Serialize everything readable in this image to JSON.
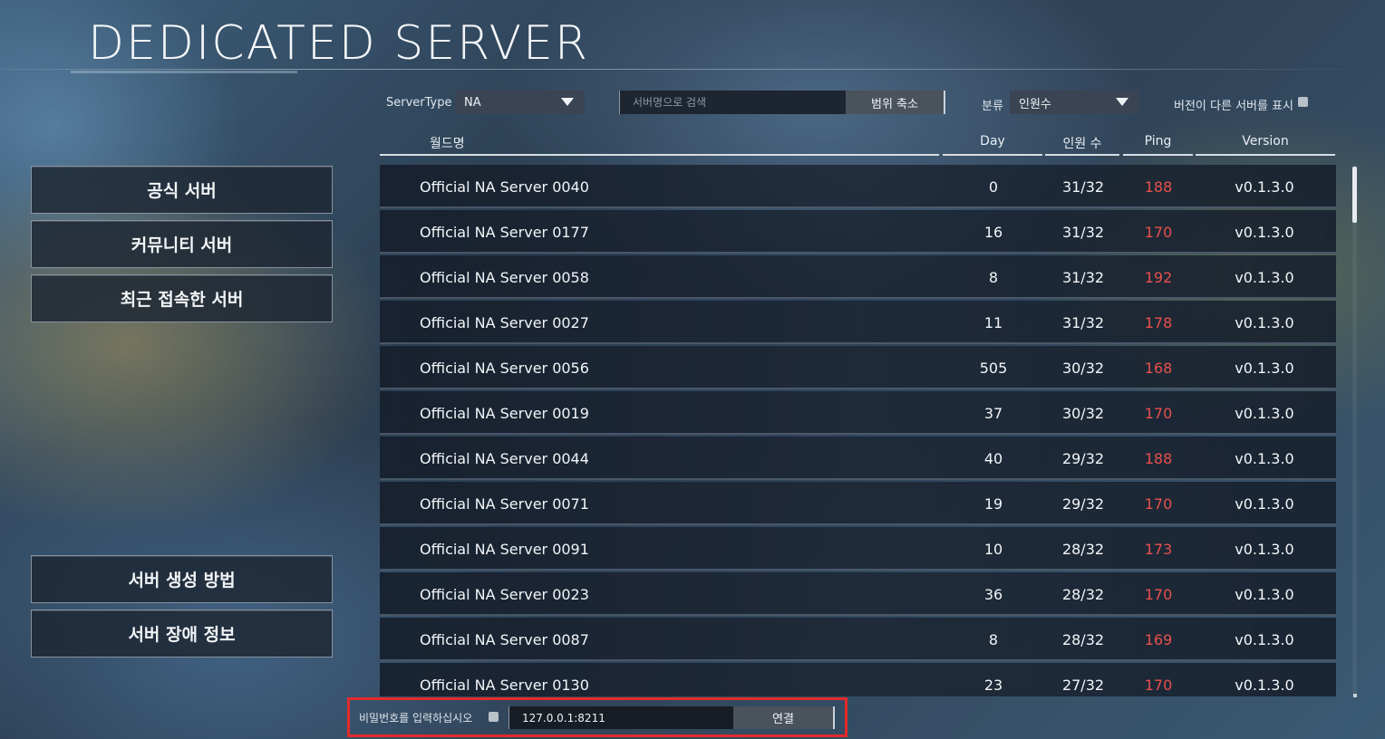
{
  "title": "DEDICATED SERVER",
  "menu": {
    "official": "공식 서버",
    "community": "커뮤니티 서버",
    "recent": "최근 접속한 서버",
    "howto": "서버 생성 방법",
    "outage": "서버 장애 정보"
  },
  "filters": {
    "server_type_label": "ServerType",
    "server_type_value": "NA",
    "search_placeholder": "서버명으로 검색",
    "search_button": "범위 축소",
    "sort_label": "분류",
    "sort_value": "인원수",
    "show_other_versions_label": "버전이 다른 서버를 표시"
  },
  "table": {
    "headers": {
      "world": "월드명",
      "day": "Day",
      "players": "인원 수",
      "ping": "Ping",
      "version": "Version"
    },
    "rows": [
      {
        "name": "Official NA Server 0040",
        "day": "0",
        "players": "31/32",
        "ping": "188",
        "version": "v0.1.3.0"
      },
      {
        "name": "Official NA Server 0177",
        "day": "16",
        "players": "31/32",
        "ping": "170",
        "version": "v0.1.3.0"
      },
      {
        "name": "Official NA Server 0058",
        "day": "8",
        "players": "31/32",
        "ping": "192",
        "version": "v0.1.3.0"
      },
      {
        "name": "Official NA Server 0027",
        "day": "11",
        "players": "31/32",
        "ping": "178",
        "version": "v0.1.3.0"
      },
      {
        "name": "Official NA Server 0056",
        "day": "505",
        "players": "30/32",
        "ping": "168",
        "version": "v0.1.3.0"
      },
      {
        "name": "Official NA Server 0019",
        "day": "37",
        "players": "30/32",
        "ping": "170",
        "version": "v0.1.3.0"
      },
      {
        "name": "Official NA Server 0044",
        "day": "40",
        "players": "29/32",
        "ping": "188",
        "version": "v0.1.3.0"
      },
      {
        "name": "Official NA Server 0071",
        "day": "19",
        "players": "29/32",
        "ping": "170",
        "version": "v0.1.3.0"
      },
      {
        "name": "Official NA Server 0091",
        "day": "10",
        "players": "28/32",
        "ping": "173",
        "version": "v0.1.3.0"
      },
      {
        "name": "Official NA Server 0023",
        "day": "36",
        "players": "28/32",
        "ping": "170",
        "version": "v0.1.3.0"
      },
      {
        "name": "Official NA Server 0087",
        "day": "8",
        "players": "28/32",
        "ping": "169",
        "version": "v0.1.3.0"
      },
      {
        "name": "Official NA Server 0130",
        "day": "23",
        "players": "27/32",
        "ping": "170",
        "version": "v0.1.3.0"
      }
    ]
  },
  "connect": {
    "password_label": "비밀번호를 입력하십시오",
    "address_value": "127.0.0.1:8211",
    "connect_button": "연결"
  },
  "colors": {
    "ping": "#e8504c",
    "highlight_box": "#e32a2a"
  }
}
